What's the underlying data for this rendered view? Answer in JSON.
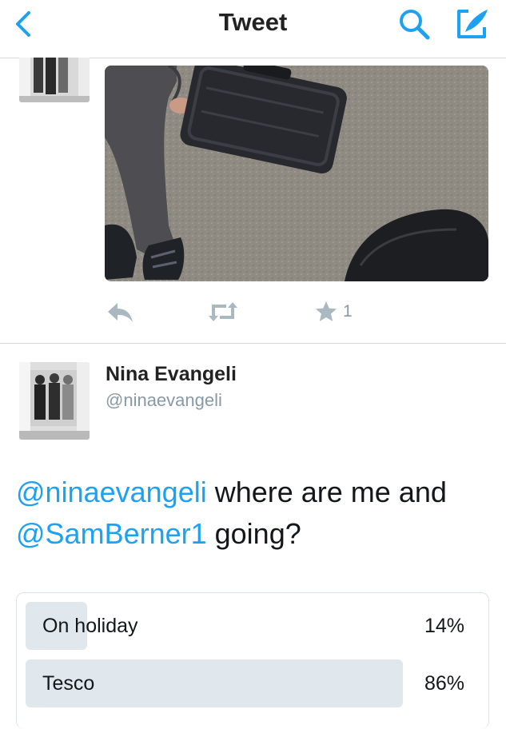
{
  "header": {
    "title": "Tweet"
  },
  "previous_tweet": {
    "like_count": "1"
  },
  "tweet": {
    "author_name": "Nina Evangeli",
    "author_handle": "@ninaevangeli",
    "text_parts": [
      {
        "text": "@ninaevangeli",
        "mention": true
      },
      {
        "text": " where are me and ",
        "mention": false
      },
      {
        "text": "@SamBerner1",
        "mention": true
      },
      {
        "text": " going?",
        "mention": false
      }
    ]
  },
  "poll": {
    "options": [
      {
        "label": "On holiday",
        "percent_text": "14%",
        "fraction": 0.14
      },
      {
        "label": "Tesco",
        "percent_text": "86%",
        "fraction": 0.86
      }
    ]
  },
  "colors": {
    "accent": "#1da1f2",
    "muted": "#8899a6",
    "poll_bar": "#e1e8ed"
  },
  "icons": [
    "back-chevron-icon",
    "search-icon",
    "compose-icon",
    "reply-icon",
    "retweet-icon",
    "star-icon"
  ]
}
